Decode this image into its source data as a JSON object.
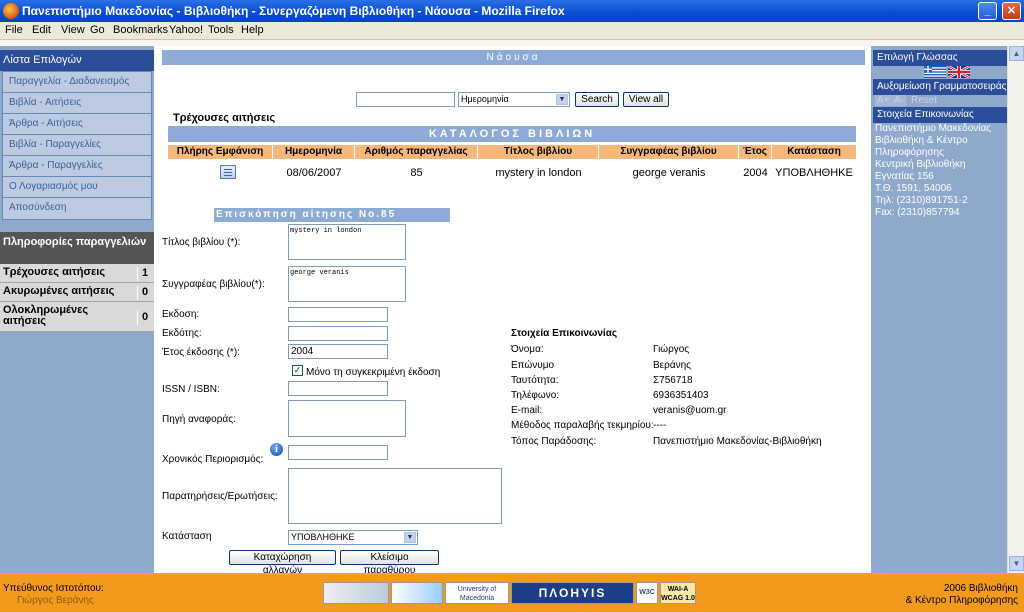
{
  "window": {
    "title": "Πανεπιστήμιο Μακεδονίας - Βιβλιοθήκη - Συνεργαζόμενη Βιβλιοθήκη - Νάουσα - Mozilla Firefox"
  },
  "menubar": [
    "File",
    "Edit",
    "View",
    "Go",
    "Bookmarks",
    "Yahoo!",
    "Tools",
    "Help"
  ],
  "left": {
    "header": "Λίστα Επιλογών",
    "menu": [
      "Παραγγελία - Διαδανεισμός",
      "Βιβλία - Αιτήσεις",
      "Άρθρα - Αιτήσεις",
      "Βιβλία - Παραγγελίες",
      "Άρθρα - Παραγγελίες",
      "Ο Λογαριασμός μου",
      "Αποσύνδεση"
    ],
    "info_header": "Πληροφορίες παραγγελιών",
    "stats": [
      {
        "label": "Τρέχουσες αιτήσεις",
        "value": "1"
      },
      {
        "label": "Ακυρωμένες αιτήσεις",
        "value": "0"
      },
      {
        "label": "Ολοκληρωμένες αιτήσεις",
        "value": "0"
      }
    ]
  },
  "right": {
    "lang_header": "Επιλογή Γλώσσας",
    "font_header": "Αυξομείωση Γραμματοσειράς",
    "font_plus": "A+",
    "font_minus": "A-",
    "font_reset": "Reset",
    "contact_header": "Στοιχεία Επικοινωνίας",
    "contact_lines": [
      "Πανεπιστήμιο Μακεδονίας",
      "Βιβλιοθήκη & Κέντρο",
      "Πληροφόρησης",
      "Κεντρική Βιβλιοθήκη",
      "Εγνατίας 156",
      "Τ.Θ. 1591, 54006",
      "Τηλ: (2310)891751-2",
      "Fax: (2310)857794"
    ]
  },
  "main": {
    "banner": "Νάουσα",
    "search": {
      "value": "",
      "select": "Ημερομηνία",
      "search_btn": "Search",
      "viewall_btn": "View all"
    },
    "current_title": "Τρέχουσες αιτήσεις",
    "catalog_title": "ΚΑΤΑΛΟΓΟΣ ΒΙΒΛΙΩΝ",
    "columns": [
      "Πλήρης Εμφάνιση",
      "Ημερομηνία",
      "Αριθμός παραγγελίας",
      "Τίτλος βιβλίου",
      "Συγγραφέας βιβλίου",
      "Έτος",
      "Κατάσταση"
    ],
    "row": {
      "date": "08/06/2007",
      "number": "85",
      "title": "mystery in london",
      "author": "george veranis",
      "year": "2004",
      "status": "ΥΠΟΒΛΗΘΗΚΕ"
    },
    "review_title": "Επισκόπηση αίτησης No.85",
    "form": {
      "title_label": "Τίτλος βιβλίου (*):",
      "title_value": "mystery in london",
      "author_label": "Συγγραφέας βιβλίου(*):",
      "author_value": "george veranis",
      "edition_label": "Εκδοση:",
      "publisher_label": "Εκδότης:",
      "year_label": "Έτος έκδοσης (*):",
      "year_value": "2004",
      "only_edition": "Μόνο τη συγκεκριμένη έκδοση",
      "isbn_label": "ISSN / ISBN:",
      "source_label": "Πηγή αναφοράς:",
      "time_label": "Χρονικός Περιορισμός:",
      "notes_label": "Παρατηρήσεις/Ερωτήσεις:",
      "status_label": "Κατάσταση",
      "status_value": "ΥΠΟΒΛΗΘΗΚΕ",
      "save_btn": "Καταχώρηση αλλαγών",
      "close_btn": "Κλείσιμο παραθύρου"
    },
    "contact": {
      "title": "Στοιχεία Επικοινωνίας",
      "rows": [
        {
          "k": "Όνομα:",
          "v": "Γιώργος"
        },
        {
          "k": "Επώνυμο",
          "v": "Βεράνης"
        },
        {
          "k": "Ταυτότητα:",
          "v": "Σ756718"
        },
        {
          "k": "Τηλέφωνο:",
          "v": "6936351403"
        },
        {
          "k": "E-mail:",
          "v": "veranis@uom.gr"
        },
        {
          "k": "Μέθοδος παραλαβής τεκμηρίου:",
          "v": "----"
        },
        {
          "k": "Τόπος Παράδοσης:",
          "v": "Πανεπιστήμιο Μακεδονίας-Βιβλιοθήκη"
        }
      ]
    }
  },
  "footer": {
    "left1": "Υπεύθυνος Ιστοτόπου:",
    "left2": "Γιώργος Βεράνης",
    "right1": "2006 Βιβλιοθήκη",
    "right2": "& Κέντρο Πληροφόρησης",
    "logo_uom": "University of Macedonia",
    "logo_plo": "ΠΛΟΗΥΙS",
    "logo_w3c": "W3C",
    "logo_wai": "WAI-A WCAG 1.0"
  }
}
